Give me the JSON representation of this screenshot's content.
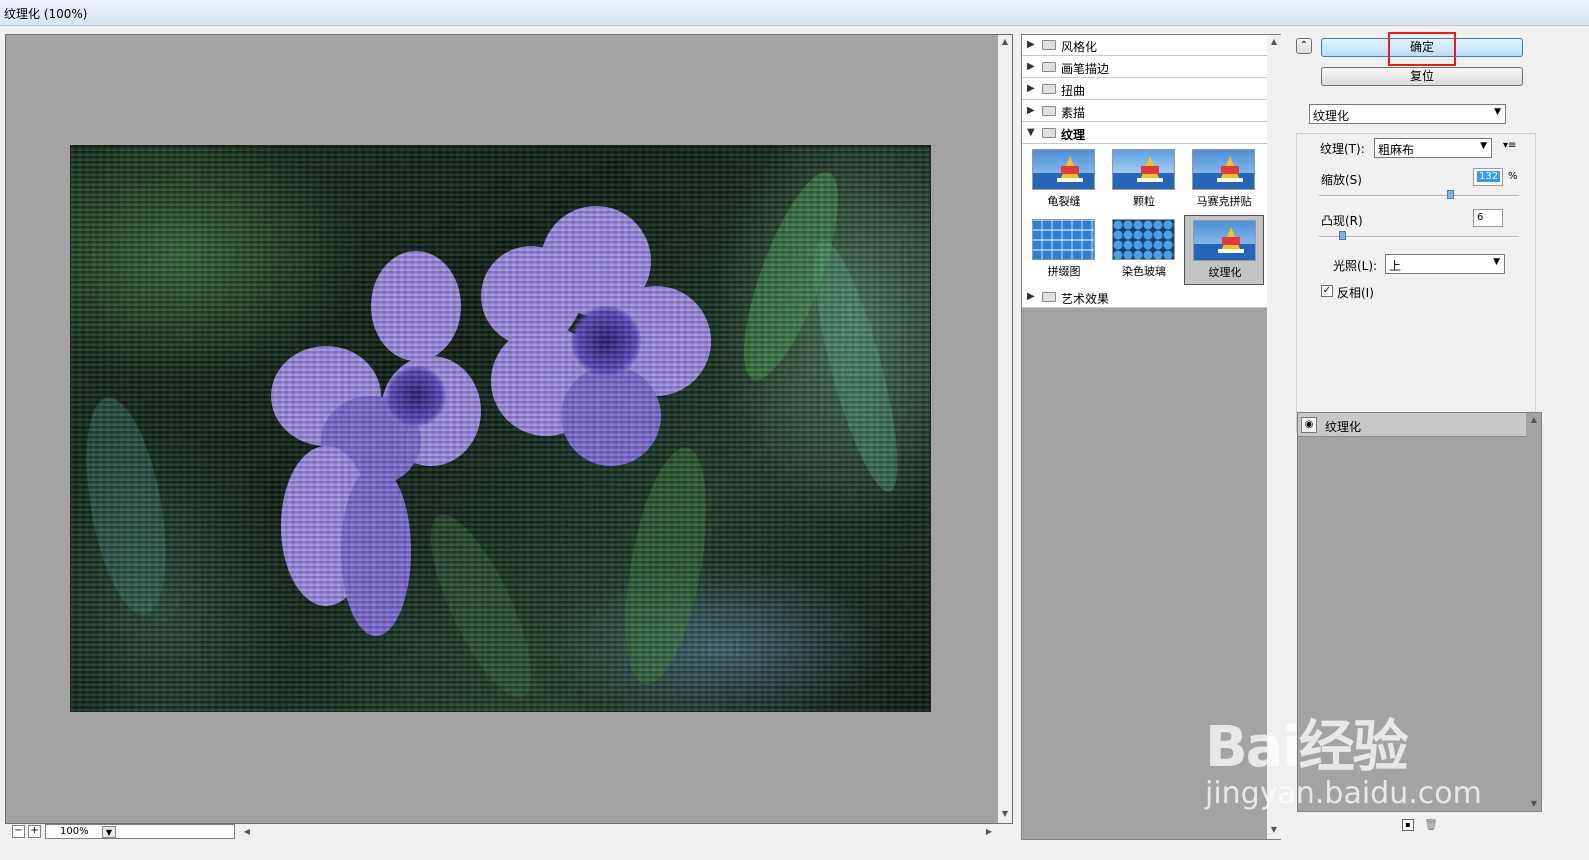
{
  "window": {
    "title": "纹理化 (100%)"
  },
  "preview": {
    "zoom": "100%"
  },
  "gallery": {
    "categories": [
      "风格化",
      "画笔描边",
      "扭曲",
      "素描",
      "纹理",
      "艺术效果"
    ],
    "open_category": "纹理",
    "filters": [
      "龟裂缝",
      "颗粒",
      "马赛克拼贴",
      "拼缀图",
      "染色玻璃",
      "纹理化"
    ],
    "selected_filter": "纹理化"
  },
  "panel": {
    "ok_label": "确定",
    "reset_label": "复位",
    "filter_select": "纹理化",
    "texture_label": "纹理(T):",
    "texture_value": "粗麻布",
    "scale_label": "缩放(S)",
    "scale_value": "132",
    "scale_unit": "%",
    "scale_level": 0.66,
    "relief_label": "凸现(R)",
    "relief_value": "6",
    "relief_level": 0.12,
    "light_label": "光照(L):",
    "light_value": "上",
    "invert_label": "反相(I)",
    "invert_checked": true
  },
  "layers": {
    "items": [
      "纹理化"
    ]
  },
  "watermark": {
    "logo": "Bai经验",
    "url": "jingyan.baidu.com"
  },
  "colors": {
    "highlight": "#e02020",
    "ok_button": "#b9dcf6",
    "preview_bg": "#a3a3a3"
  },
  "icons": [
    "expand-toggle-icon",
    "folder-icon",
    "eye-icon",
    "new-layer-icon",
    "delete-layer-icon",
    "dropdown-arrow-icon",
    "menu-icon"
  ]
}
